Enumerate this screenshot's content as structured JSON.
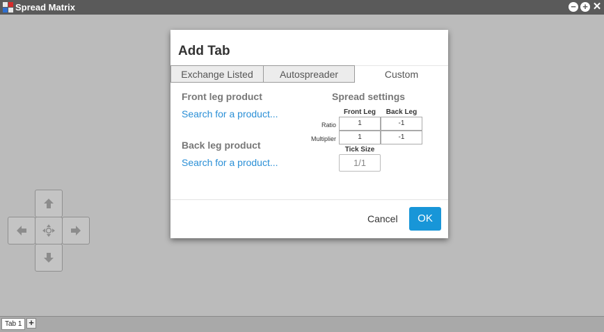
{
  "window": {
    "title": "Spread Matrix",
    "minimize_glyph": "−",
    "maximize_glyph": "+",
    "close_glyph": "✕"
  },
  "dialog": {
    "title": "Add Tab",
    "tabs": [
      {
        "label": "Exchange Listed",
        "active": false
      },
      {
        "label": "Autospreader",
        "active": false
      },
      {
        "label": "Custom",
        "active": true
      }
    ],
    "front_leg": {
      "heading": "Front leg product",
      "search_text": "Search for a product..."
    },
    "back_leg": {
      "heading": "Back leg product",
      "search_text": "Search for a product..."
    },
    "spread_settings": {
      "heading": "Spread settings",
      "columns": [
        "Front Leg",
        "Back Leg"
      ],
      "rows": [
        {
          "label": "Ratio",
          "front": "1",
          "back": "-1"
        },
        {
          "label": "Multiplier",
          "front": "1",
          "back": "-1"
        }
      ],
      "tick_size_label": "Tick Size",
      "tick_size_value": "1/1"
    },
    "cancel_label": "Cancel",
    "ok_label": "OK"
  },
  "dpad": {
    "icons": [
      "arrow-up-icon",
      "arrow-left-icon",
      "move-center-icon",
      "arrow-right-icon",
      "arrow-down-icon"
    ]
  },
  "bottom_tabs": {
    "tabs": [
      "Tab 1"
    ],
    "add_label": "+"
  },
  "colors": {
    "accent": "#1896d8",
    "link": "#2a8fd6",
    "titlebar": "#5a5a5a"
  }
}
